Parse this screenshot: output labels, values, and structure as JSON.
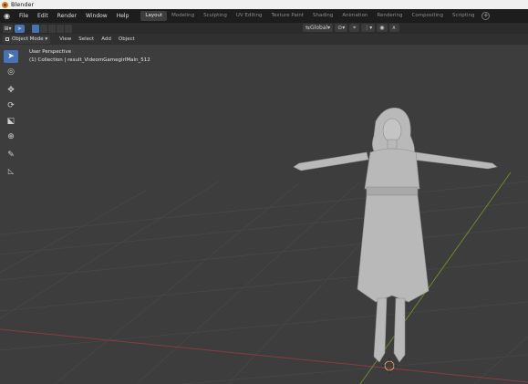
{
  "window": {
    "title": "Blender"
  },
  "menubar": {
    "items": [
      "File",
      "Edit",
      "Render",
      "Window",
      "Help"
    ],
    "workspaces": [
      {
        "label": "Layout",
        "active": true
      },
      {
        "label": "Modeling",
        "active": false
      },
      {
        "label": "Sculpting",
        "active": false
      },
      {
        "label": "UV Editing",
        "active": false
      },
      {
        "label": "Texture Paint",
        "active": false
      },
      {
        "label": "Shading",
        "active": false
      },
      {
        "label": "Animation",
        "active": false
      },
      {
        "label": "Rendering",
        "active": false
      },
      {
        "label": "Compositing",
        "active": false
      },
      {
        "label": "Scripting",
        "active": false
      }
    ],
    "add_workspace_glyph": "+"
  },
  "toolheader": {
    "editor_type_icon": "3d-viewport-icon",
    "select_mode_icon": "cursor-icon",
    "transform_orientation": "Global",
    "pivot_icon": "pivot-icon",
    "snap_icon": "magnet-icon",
    "proportional_icon": "proportional-edit-icon"
  },
  "viewheader": {
    "mode": "Object Mode",
    "menus": [
      "View",
      "Select",
      "Add",
      "Object"
    ]
  },
  "viewport": {
    "perspective_label": "User Perspective",
    "collection_label": "(1) Collection | result_VideomGamegirlMain_512",
    "colors": {
      "background": "#3d3d3d",
      "grid": "#4a4a4a",
      "x_axis": "#8b3a44",
      "y_axis": "#6a8a2a",
      "model": "#b9b9b9",
      "cursor_ring": "#e87d0d"
    }
  },
  "lefttools": [
    {
      "name": "select-box-tool",
      "icon": "cursor-icon",
      "glyph": "➤",
      "active": true
    },
    {
      "name": "cursor-tool",
      "icon": "3d-cursor-icon",
      "glyph": "◎",
      "active": false
    },
    {
      "name": "move-tool",
      "icon": "move-icon",
      "glyph": "✥",
      "active": false
    },
    {
      "name": "rotate-tool",
      "icon": "rotate-icon",
      "glyph": "⟳",
      "active": false
    },
    {
      "name": "scale-tool",
      "icon": "scale-icon",
      "glyph": "⬕",
      "active": false
    },
    {
      "name": "transform-tool",
      "icon": "transform-icon",
      "glyph": "⊕",
      "active": false
    },
    {
      "name": "annotate-tool",
      "icon": "annotate-icon",
      "glyph": "✎",
      "active": false
    },
    {
      "name": "measure-tool",
      "icon": "measure-icon",
      "glyph": "📐",
      "active": false
    }
  ]
}
